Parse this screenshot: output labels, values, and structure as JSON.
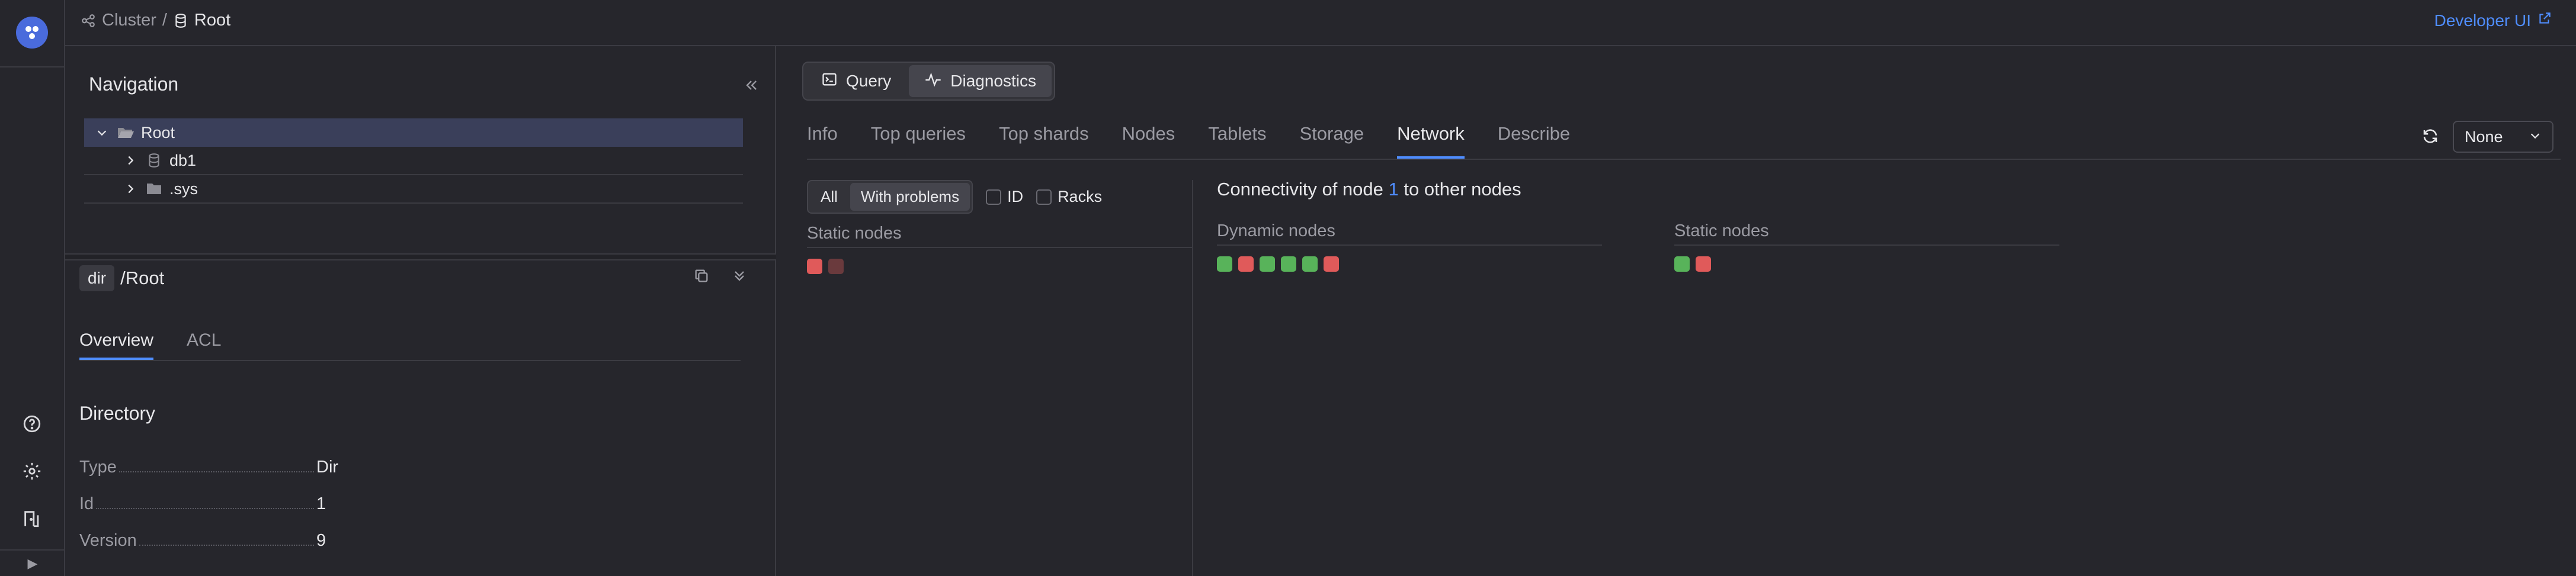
{
  "breadcrumbs": {
    "cluster": "Cluster",
    "separator": "/",
    "root": "Root"
  },
  "header": {
    "developer_ui": "Developer UI"
  },
  "navigation": {
    "title": "Navigation",
    "tree": [
      {
        "label": "Root",
        "level": 0,
        "selected": true,
        "expanded": true,
        "icon": "folder-open-icon"
      },
      {
        "label": "db1",
        "level": 1,
        "icon": "database-icon"
      },
      {
        "label": ".sys",
        "level": 1,
        "icon": "folder-icon"
      }
    ]
  },
  "path": {
    "type_badge": "dir",
    "value": "/Root"
  },
  "subtabs": {
    "overview": "Overview",
    "acl": "ACL"
  },
  "directory": {
    "title": "Directory",
    "props": [
      {
        "key": "Type",
        "value": "Dir"
      },
      {
        "key": "Id",
        "value": "1"
      },
      {
        "key": "Version",
        "value": "9"
      }
    ]
  },
  "mode": {
    "query": "Query",
    "diagnostics": "Diagnostics"
  },
  "tabs": [
    "Info",
    "Top queries",
    "Top shards",
    "Nodes",
    "Tablets",
    "Storage",
    "Network",
    "Describe"
  ],
  "active_tab": "Network",
  "select": {
    "value": "None"
  },
  "filters": {
    "all": "All",
    "with_problems": "With problems",
    "id": "ID",
    "racks": "Racks"
  },
  "left_static": {
    "title": "Static nodes",
    "nodes": [
      "red",
      "darkred"
    ]
  },
  "connectivity": {
    "prefix": "Connectivity of node",
    "node": "1",
    "suffix": "to other nodes"
  },
  "dynamic_nodes": {
    "title": "Dynamic nodes",
    "nodes": [
      "green",
      "red",
      "green",
      "green",
      "green",
      "red"
    ]
  },
  "static_nodes": {
    "title": "Static nodes",
    "nodes": [
      "green",
      "red"
    ]
  },
  "colors": {
    "accent": "#4f8dff",
    "ok": "#58b35a",
    "error": "#e05a5a",
    "offline": "#6a3a3d"
  }
}
